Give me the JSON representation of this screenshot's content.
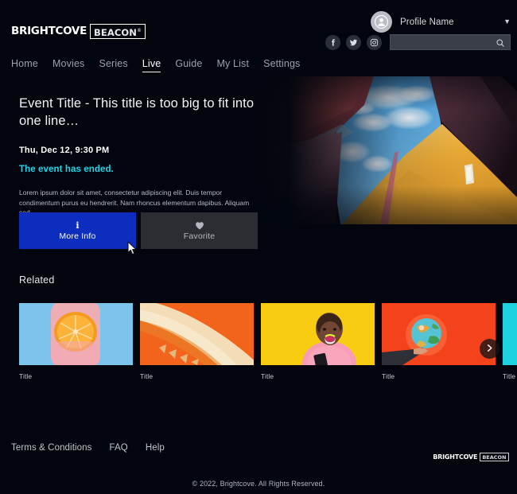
{
  "brand": {
    "name": "BRIGHTCOVE",
    "product": "BEACON"
  },
  "header": {
    "profile": {
      "name": "Profile Name",
      "avatar_icon": "user-avatar-icon",
      "dropdown_icon": "chevron-down-icon"
    },
    "social": [
      {
        "name": "facebook",
        "label": "f"
      },
      {
        "name": "twitter",
        "label": "t"
      },
      {
        "name": "instagram",
        "label": "i"
      }
    ],
    "search": {
      "value": "",
      "placeholder": "",
      "icon": "search-icon"
    },
    "nav": [
      {
        "label": "Home",
        "active": false
      },
      {
        "label": "Movies",
        "active": false
      },
      {
        "label": "Series",
        "active": false
      },
      {
        "label": "Live",
        "active": true
      },
      {
        "label": "Guide",
        "active": false
      },
      {
        "label": "My List",
        "active": false
      },
      {
        "label": "Settings",
        "active": false
      }
    ]
  },
  "hero": {
    "title": "Event Title - This title is too big to fit into one line…",
    "date": "Thu, Dec 12, 9:30 PM",
    "status": "The event has ended.",
    "status_color": "#21d4e8",
    "description": "Lorem ipsum dolor sit amet, consectetur adipiscing elit. Duis tempor condimentum purus eu hendrerit. Nam rhoncus elementum dapibus. Aliquam sed…",
    "buttons": [
      {
        "label": "More Info",
        "icon": "info-icon",
        "style": "primary",
        "color": "#0c2dbd"
      },
      {
        "label": "Favorite",
        "icon": "heart-icon",
        "style": "secondary",
        "color": "#2b2d33"
      }
    ]
  },
  "related": {
    "heading": "Related",
    "next_icon": "chevron-right-icon",
    "cards": [
      {
        "title": "Title",
        "art": "orange-slice-in-pink-gel-on-blue"
      },
      {
        "title": "Title",
        "art": "gold-arc-on-orange"
      },
      {
        "title": "Title",
        "art": "laughing-woman-pink-shirt-on-yellow"
      },
      {
        "title": "Title",
        "art": "hand-holding-globe-on-red"
      },
      {
        "title": "Title",
        "art": "cyan-panel"
      }
    ]
  },
  "footer": {
    "links": [
      "Terms & Conditions",
      "FAQ",
      "Help"
    ],
    "copyright": "© 2022, Brightcove. All Rights Reserved."
  }
}
